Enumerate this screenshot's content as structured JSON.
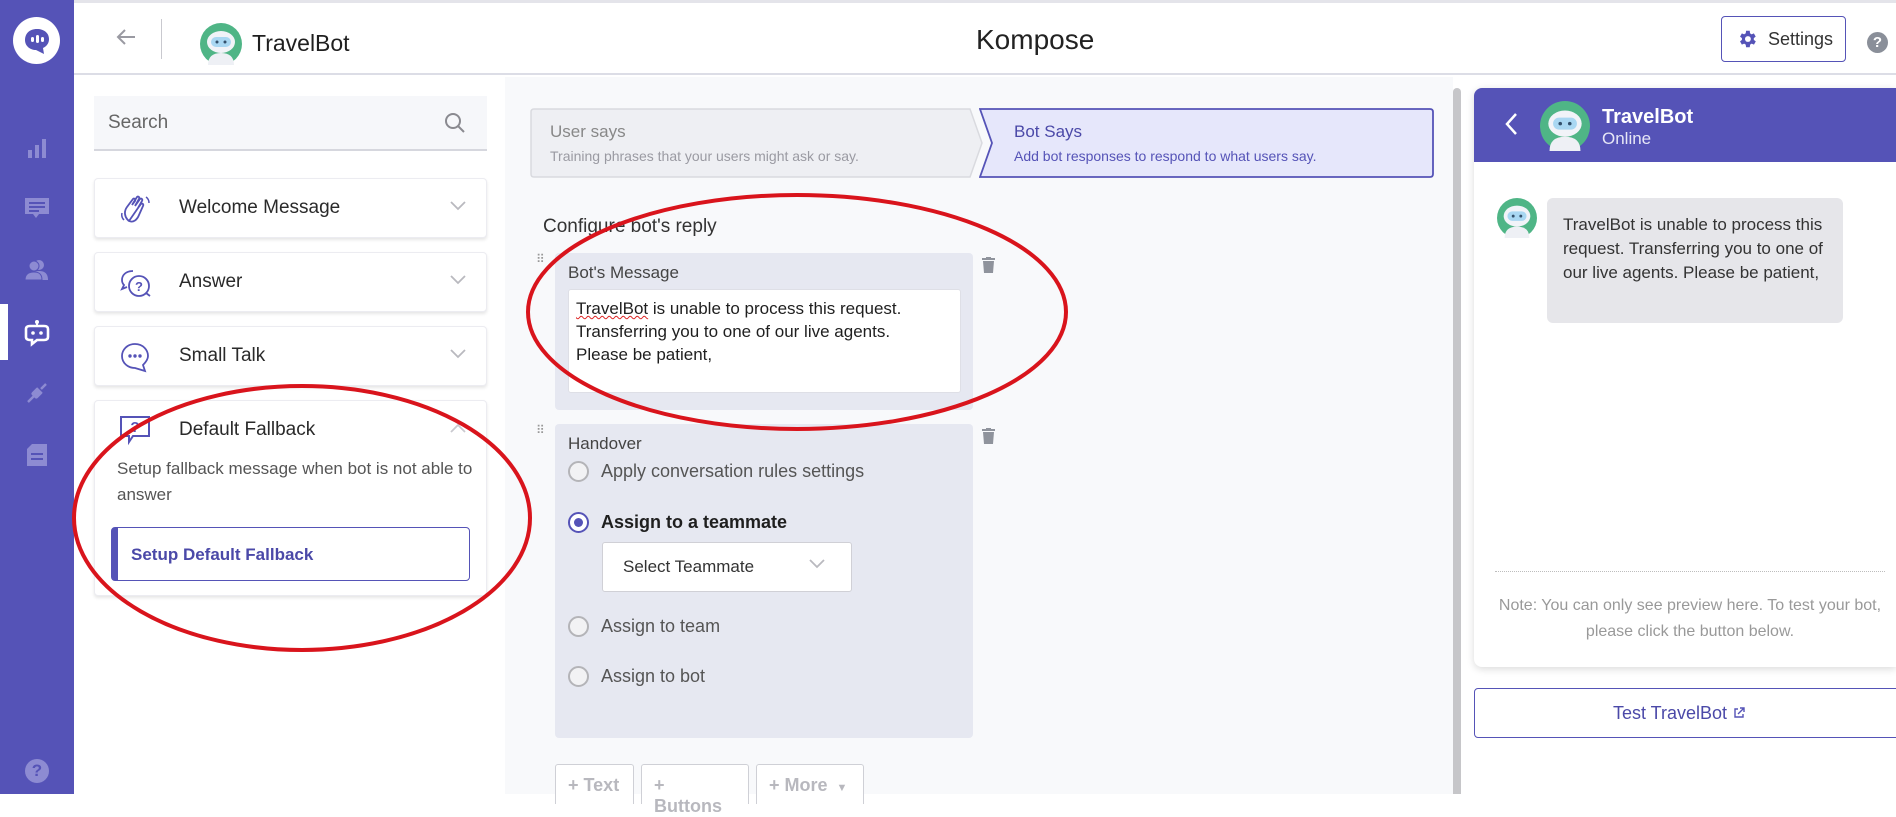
{
  "app": {
    "header": {
      "bot_name": "TravelBot",
      "page_title": "Kompose",
      "settings_label": "Settings",
      "help_icon": "?"
    },
    "sidebar": {
      "items": [
        {
          "icon": "chat-logo-icon",
          "active": false
        },
        {
          "icon": "bar-chart-icon",
          "active": false
        },
        {
          "icon": "conversations-icon",
          "active": false
        },
        {
          "icon": "users-icon",
          "active": false
        },
        {
          "icon": "bot-icon",
          "active": true
        },
        {
          "icon": "integrations-icon",
          "active": false
        },
        {
          "icon": "document-icon",
          "active": false
        },
        {
          "icon": "help-icon",
          "active": false
        }
      ],
      "help_glyph": "?"
    }
  },
  "left": {
    "search": {
      "placeholder": "Search"
    },
    "intents": [
      {
        "title": "Welcome Message",
        "icon": "wave-hand-icon",
        "expanded": false
      },
      {
        "title": "Answer",
        "icon": "question-bubble-icon",
        "expanded": false
      },
      {
        "title": "Small Talk",
        "icon": "chat-dots-icon",
        "expanded": false
      },
      {
        "title": "Default Fallback",
        "icon": "fallback-question-icon",
        "expanded": true,
        "description": "Setup fallback message when bot is not able to answer",
        "button_label": "Setup Default Fallback"
      }
    ]
  },
  "center": {
    "steps": [
      {
        "title": "User says",
        "subtitle": "Training phrases that your users might ask or say.",
        "active": false
      },
      {
        "title": "Bot Says",
        "subtitle": "Add bot responses to respond to what users say.",
        "active": true
      }
    ],
    "configure_title": "Configure bot's reply",
    "bot_message": {
      "label": "Bot's Message",
      "misspelled_word": "TravelBot",
      "text_rest_line1": " is unable to process this request.",
      "line2": "Transferring you to one of our live agents.",
      "line3": "Please be patient,"
    },
    "handover": {
      "label": "Handover",
      "options": [
        {
          "label": "Apply conversation rules settings",
          "selected": false
        },
        {
          "label": "Assign to a teammate",
          "selected": true
        },
        {
          "label": "Assign to team",
          "selected": false
        },
        {
          "label": "Assign to bot",
          "selected": false
        }
      ],
      "teammate_select": {
        "value": "Select Teammate"
      }
    },
    "add_buttons": [
      "+ Text",
      "+ Buttons",
      "+ More"
    ]
  },
  "preview": {
    "bot_name": "TravelBot",
    "status": "Online",
    "message": "TravelBot is unable to process this request. Transferring you to one of our live agents. Please be patient,",
    "note": "Note: You can only see preview here. To test your bot, please click the button below.",
    "test_button_label": "Test TravelBot"
  },
  "colors": {
    "brand": "#5553b7",
    "annotation_red": "#d9141c",
    "bot_avatar_green": "#4fb586"
  }
}
